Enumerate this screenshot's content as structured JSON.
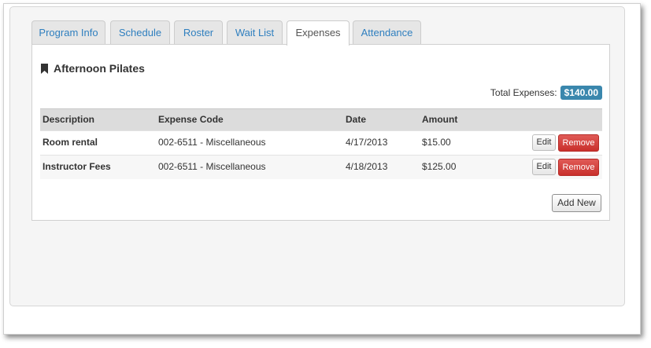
{
  "tabs": [
    {
      "label": "Program Info",
      "active": false
    },
    {
      "label": "Schedule",
      "active": false
    },
    {
      "label": "Roster",
      "active": false
    },
    {
      "label": "Wait List",
      "active": false
    },
    {
      "label": "Expenses",
      "active": true
    },
    {
      "label": "Attendance",
      "active": false
    }
  ],
  "program": {
    "title": "Afternoon Pilates",
    "icon": "bookmark-icon"
  },
  "total": {
    "label": "Total Expenses:",
    "value": "$140.00"
  },
  "table": {
    "headers": [
      "Description",
      "Expense Code",
      "Date",
      "Amount"
    ],
    "rows": [
      {
        "description": "Room rental",
        "code": "002-6511 - Miscellaneous",
        "date": "4/17/2013",
        "amount": "$15.00",
        "edit": "Edit",
        "remove": "Remove"
      },
      {
        "description": "Instructor Fees",
        "code": "002-6511 - Miscellaneous",
        "date": "4/18/2013",
        "amount": "$125.00",
        "edit": "Edit",
        "remove": "Remove"
      }
    ]
  },
  "actions": {
    "add_new": "Add New"
  },
  "colors": {
    "link": "#2f7fbf",
    "badge": "#3a87ad",
    "danger": "#c9302c"
  }
}
